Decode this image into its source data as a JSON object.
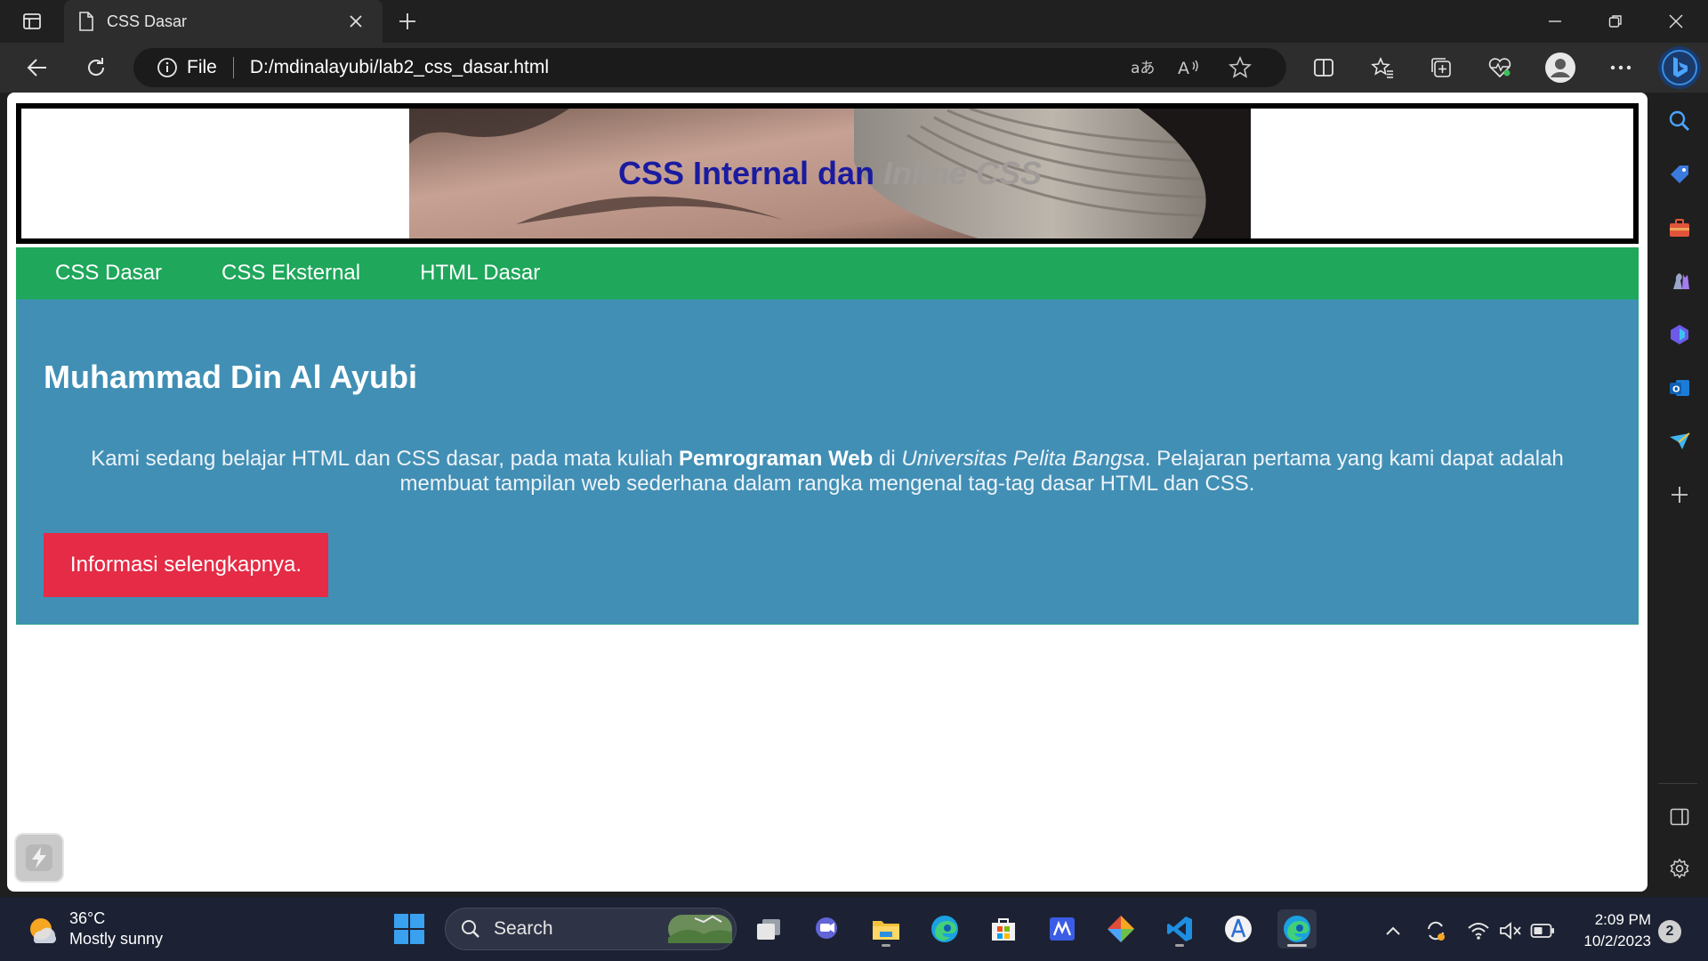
{
  "browser": {
    "tab_title": "CSS Dasar",
    "protocol_label": "File",
    "url": "D:/mdinalayubi/lab2_css_dasar.html"
  },
  "page": {
    "header_title_main": "CSS Internal dan",
    "header_title_italic": "Inline CSS",
    "nav": [
      "CSS Dasar",
      "CSS Eksternal",
      "HTML Dasar"
    ],
    "hero": {
      "title": "Muhammad Din Al Ayubi",
      "text_part1": "Kami sedang belajar HTML dan CSS dasar, pada mata kuliah ",
      "text_bold": "Pemrograman Web",
      "text_part2": " di ",
      "text_italic": "Universitas Pelita Bangsa",
      "text_part3": ". Pelajaran pertama yang kami dapat adalah membuat tampilan web sederhana dalam rangka mengenal tag-tag dasar HTML dan CSS.",
      "button_label": "Informasi selengkapnya."
    }
  },
  "taskbar": {
    "weather_temp": "36°C",
    "weather_condition": "Mostly sunny",
    "search_label": "Search",
    "clock_time": "2:09 PM",
    "clock_date": "10/2/2023",
    "notification_count": "2"
  },
  "colors": {
    "nav_bg": "#1fa75b",
    "hero_bg": "#418fb5",
    "button_bg": "#e52b45",
    "header_title": "#1b1ba0"
  }
}
